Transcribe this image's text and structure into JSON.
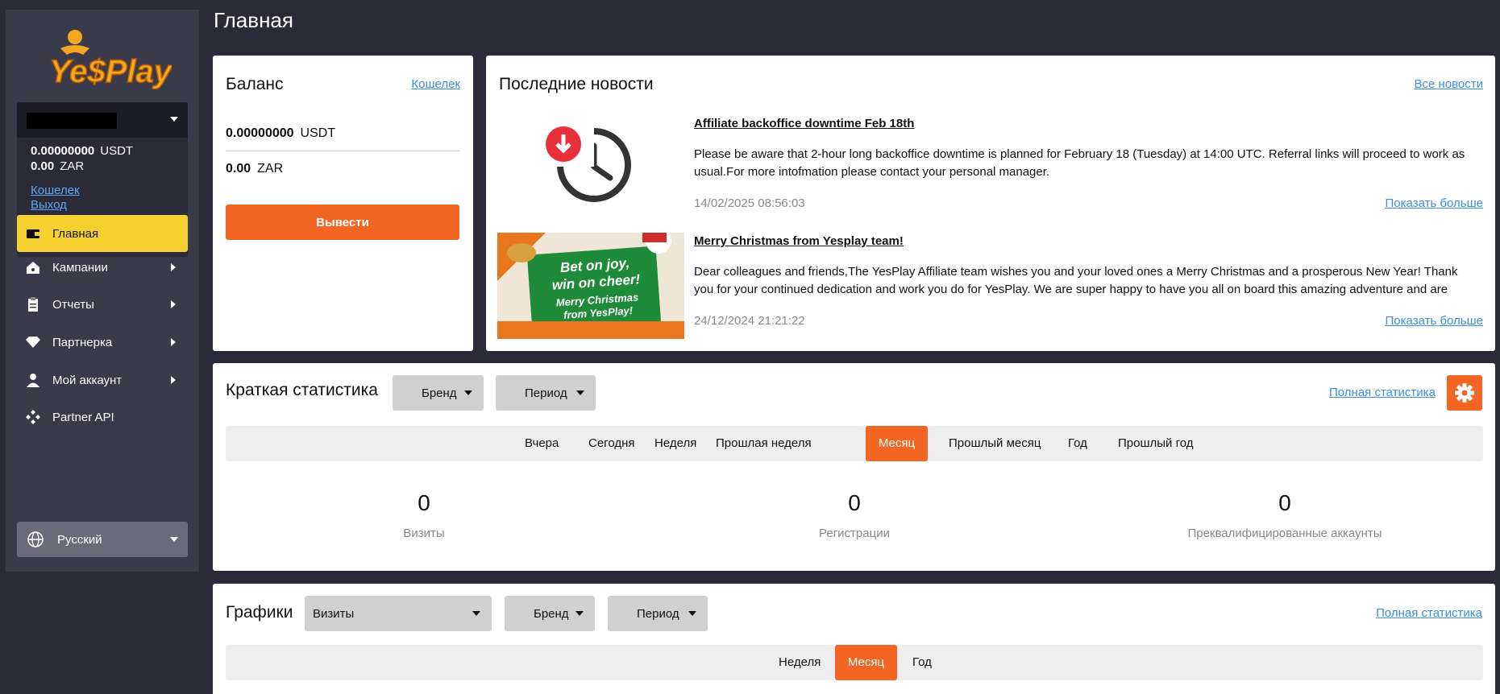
{
  "header": {
    "title": "Главная"
  },
  "sidebar": {
    "logo_text": "YesPlay",
    "account": {
      "balances": [
        {
          "amount": "0.00000000",
          "currency": "USDT"
        },
        {
          "amount": "0.00",
          "currency": "ZAR"
        }
      ],
      "wallet_link": "Кошелек",
      "logout_link": "Выход"
    },
    "nav": [
      {
        "label": "Главная",
        "icon": "wallet-icon",
        "active": true
      },
      {
        "label": "Кампании",
        "icon": "home-icon"
      },
      {
        "label": "Отчеты",
        "icon": "clipboard-icon"
      },
      {
        "label": "Партнерка",
        "icon": "diamond-icon"
      },
      {
        "label": "Мой аккаунт",
        "icon": "user-icon"
      },
      {
        "label": "Partner API",
        "icon": "api-icon"
      }
    ],
    "language": {
      "label": "Русский",
      "icon": "globe-icon"
    }
  },
  "balance_card": {
    "title": "Баланс",
    "wallet_link": "Кошелек",
    "rows": [
      {
        "amount": "0.00000000",
        "currency": "USDT"
      },
      {
        "amount": "0.00",
        "currency": "ZAR"
      }
    ],
    "withdraw_button": "Вывести"
  },
  "news_card": {
    "title": "Последние новости",
    "all_link": "Все новости",
    "items": [
      {
        "title": "Affiliate backoffice downtime Feb 18th",
        "text": "Please be aware that 2-hour long backoffice downtime is planned for February 18 (Tuesday) at 14:00 UTC. Referral links will proceed to work as usual.For more intofmation please contact your personal manager.",
        "date": "14/02/2025 08:56:03",
        "more": "Показать больше"
      },
      {
        "title": "Merry Christmas from Yesplay team!",
        "text": "Dear colleagues and friends,The YesPlay Affiliate team wishes you and your loved ones a Merry Christmas and a prosperous New Year! Thank you for your continued dedication and work you do for YesPlay. We are super happy to have you all on board this amazing adventure and are ready to …",
        "date": "24/12/2024 21:21:22",
        "more": "Показать больше",
        "image_text": {
          "line1": "Bet on joy,",
          "line2": "win on cheer!",
          "line3": "Merry Christmas",
          "line4": "from YesPlay!"
        }
      }
    ]
  },
  "stats_card": {
    "title": "Краткая статистика",
    "brand_dropdown": "Бренд",
    "period_dropdown": "Период",
    "full_link": "Полная статистика",
    "tabs": [
      "Вчера",
      "Сегодня",
      "Неделя",
      "Прошлая неделя",
      "Месяц",
      "Прошлый месяц",
      "Год",
      "Прошлый год"
    ],
    "active_tab": "Месяц",
    "metrics": [
      {
        "value": "0",
        "label": "Визиты"
      },
      {
        "value": "0",
        "label": "Регистрации"
      },
      {
        "value": "0",
        "label": "Преквалифицированные аккаунты"
      }
    ]
  },
  "charts_card": {
    "title": "Графики",
    "metric_dropdown": "Визиты",
    "brand_dropdown": "Бренд",
    "period_dropdown": "Период",
    "full_link": "Полная статистика",
    "tabs": [
      "Неделя",
      "Месяц",
      "Год"
    ],
    "active_tab": "Месяц"
  },
  "colors": {
    "accent": "#f26522",
    "active_nav": "#f5d130",
    "sidebar_bg": "#3a3a4a",
    "page_bg": "#2a2a38"
  }
}
